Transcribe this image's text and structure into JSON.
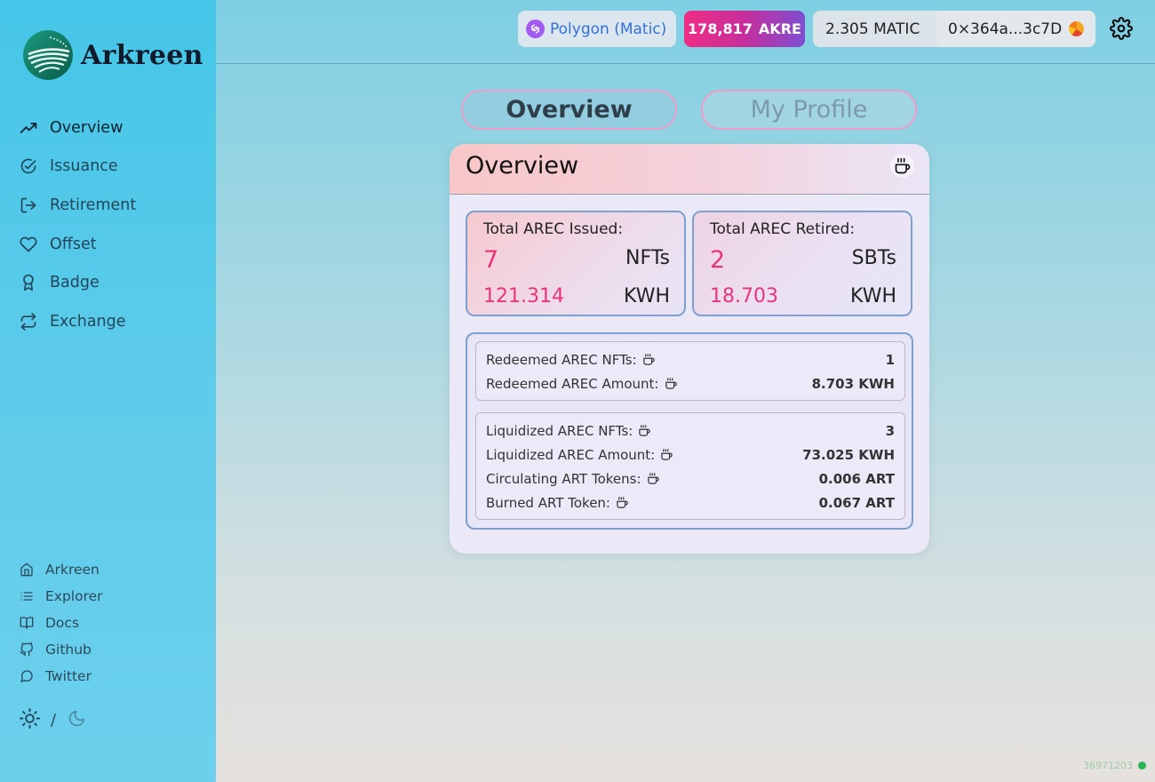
{
  "app": {
    "name": "Arkreen"
  },
  "sidebar": {
    "nav": [
      {
        "label": "Overview",
        "icon": "trending-up-icon",
        "active": true
      },
      {
        "label": "Issuance",
        "icon": "check-circle-icon"
      },
      {
        "label": "Retirement",
        "icon": "log-out-icon"
      },
      {
        "label": "Offset",
        "icon": "heart-icon"
      },
      {
        "label": "Badge",
        "icon": "award-icon"
      },
      {
        "label": "Exchange",
        "icon": "repeat-icon"
      }
    ],
    "links": [
      {
        "label": "Arkreen",
        "icon": "home-icon"
      },
      {
        "label": "Explorer",
        "icon": "list-icon"
      },
      {
        "label": "Docs",
        "icon": "book-open-icon"
      },
      {
        "label": "Github",
        "icon": "github-icon"
      },
      {
        "label": "Twitter",
        "icon": "message-circle-icon"
      }
    ],
    "theme_separator": "/"
  },
  "header": {
    "network": "Polygon (Matic)",
    "akre_amount": "178,817",
    "akre_symbol": "AKRE",
    "balance": "2.305 MATIC",
    "address": "0×364a...3c7D"
  },
  "tabs": [
    {
      "label": "Overview",
      "active": true
    },
    {
      "label": "My Profile",
      "active": false
    }
  ],
  "card": {
    "title": "Overview",
    "issued": {
      "title": "Total AREC Issued:",
      "count": "7",
      "count_unit": "NFTs",
      "amount": "121.314",
      "amount_unit": "KWH"
    },
    "retired": {
      "title": "Total AREC Retired:",
      "count": "2",
      "count_unit": "SBTs",
      "amount": "18.703",
      "amount_unit": "KWH"
    },
    "redeemed": [
      {
        "label": "Redeemed AREC NFTs:",
        "value": "1"
      },
      {
        "label": "Redeemed AREC Amount:",
        "value": "8.703 KWH"
      }
    ],
    "liquidized": [
      {
        "label": "Liquidized AREC NFTs:",
        "value": "3"
      },
      {
        "label": "Liquidized AREC Amount:",
        "value": "73.025 KWH"
      },
      {
        "label": "Circulating ART Tokens:",
        "value": "0.006 ART"
      },
      {
        "label": "Burned ART Token:",
        "value": "0.067 ART"
      }
    ]
  },
  "footer": {
    "block_number": "36971203"
  },
  "colors": {
    "accent_pink": "#e8347a",
    "network_link": "#3470d8",
    "status_green": "#28b457"
  }
}
